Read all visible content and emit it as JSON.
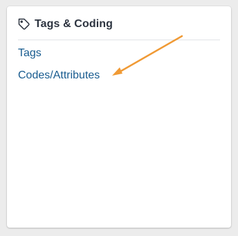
{
  "card": {
    "title": "Tags & Coding",
    "links": [
      {
        "label": "Tags"
      },
      {
        "label": "Codes/Attributes"
      }
    ]
  },
  "icons": {
    "title_icon": "tag-icon",
    "annotation": "arrow-annotation"
  },
  "colors": {
    "link": "#185b8f",
    "title": "#2d3440",
    "arrow": "#f09a35"
  }
}
